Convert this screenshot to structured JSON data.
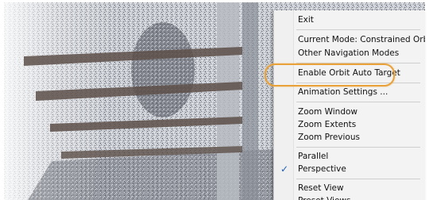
{
  "menu": {
    "items": [
      {
        "label": "Exit",
        "checked": false
      },
      {
        "label": "Current Mode: Constrained Orbit",
        "checked": false
      },
      {
        "label": "Other Navigation Modes",
        "checked": false
      },
      {
        "label": "Enable Orbit Auto Target",
        "checked": false,
        "highlighted": true
      },
      {
        "label": "Animation Settings ...",
        "checked": false
      },
      {
        "label": "Zoom Window",
        "checked": false
      },
      {
        "label": "Zoom Extents",
        "checked": false
      },
      {
        "label": "Zoom Previous",
        "checked": false
      },
      {
        "label": "Parallel",
        "checked": false
      },
      {
        "label": "Perspective",
        "checked": true
      },
      {
        "label": "Reset View",
        "checked": false
      },
      {
        "label": "Preset Views",
        "checked": false
      }
    ],
    "check_glyph": "✓"
  },
  "colors": {
    "highlight_ring": "#e9a13a",
    "menu_background": "#f3f3f3",
    "check_mark": "#1f5fb6"
  },
  "icons": {
    "check": "check-icon"
  }
}
